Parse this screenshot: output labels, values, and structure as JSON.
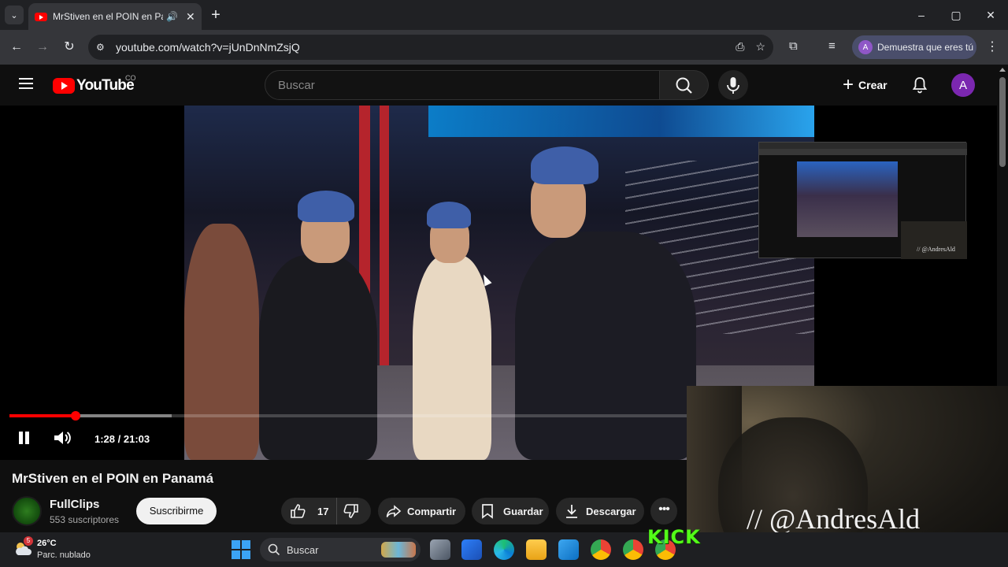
{
  "browser": {
    "tab_title": "MrStiven en el POIN en Panamá",
    "url": "youtube.com/watch?v=jUnDnNmZsjQ",
    "profile_pill_label": "Demuestra que eres tú",
    "profile_initial": "A",
    "window_controls": [
      "–",
      "▢",
      "✕"
    ]
  },
  "youtube": {
    "logo_text": "YouTube",
    "country_code": "CO",
    "search_placeholder": "Buscar",
    "create_label": "Crear",
    "avatar_initial": "A"
  },
  "player": {
    "current_time": "1:28",
    "duration": "21:03",
    "time_display": "1:28 / 21:03",
    "progress_played_fraction": 0.1,
    "progress_buffered_fraction": 0.24
  },
  "overlay": {
    "streamer_handle": "// @AndresAld",
    "mini_handle": "// @AndresAld",
    "kick_logo": "KICK"
  },
  "video": {
    "title": "MrStiven en el POIN en Panamá",
    "channel_name": "FullClips",
    "subscribers": "553 suscriptores",
    "subscribe_label": "Suscribirme",
    "likes": "17",
    "share_label": "Compartir",
    "save_label": "Guardar",
    "download_label": "Descargar"
  },
  "taskbar": {
    "weather_temp": "26°C",
    "weather_desc": "Parc. nublado",
    "weather_badge": "5",
    "search_label": "Buscar"
  },
  "colors": {
    "youtube_red": "#ff0000",
    "kick_green": "#53fc18",
    "avatar_purple": "#7b27b0"
  }
}
